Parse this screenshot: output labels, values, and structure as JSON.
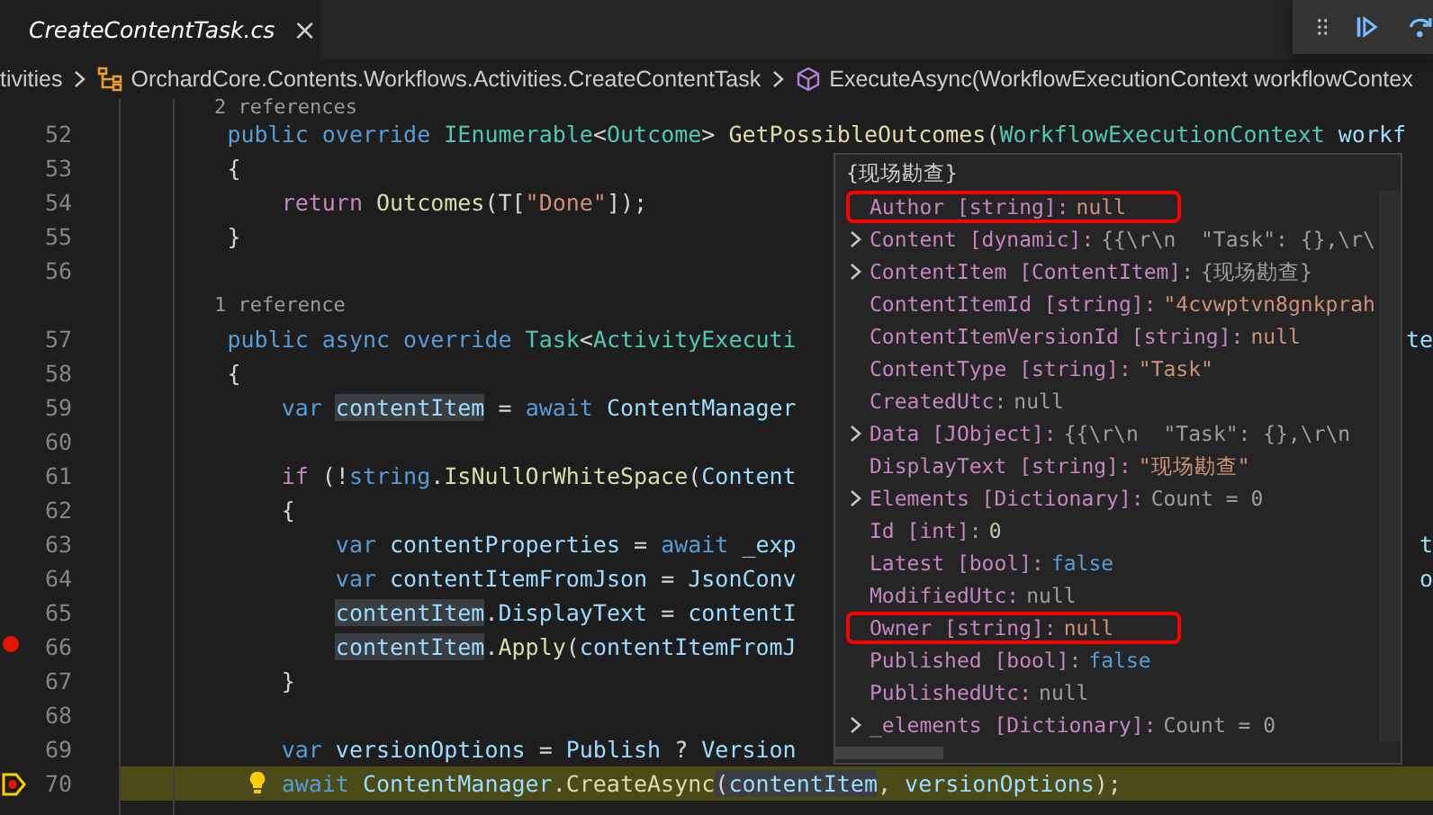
{
  "tab": {
    "title": "CreateContentTask.cs",
    "preview": true,
    "close": "×"
  },
  "breadcrumb": [
    {
      "text": "tivities"
    },
    {
      "text": "OrchardCore.Contents.Workflows.Activities.CreateContentTask"
    },
    {
      "text": "ExecuteAsync(WorkflowExecutionContext workflowContex"
    }
  ],
  "lines": [
    {
      "kind": "codelens",
      "text": "        2 references"
    },
    {
      "kind": "code",
      "number": "52",
      "breakpoint": false,
      "current": false,
      "segments": [
        {
          "t": "        public override ",
          "kind": "kw"
        },
        {
          "t": "IEnumerable",
          "kind": "type"
        },
        {
          "t": "<",
          "kind": "plain"
        },
        {
          "t": "Outcome",
          "kind": "type"
        },
        {
          "t": "> ",
          "kind": "plain"
        },
        {
          "t": "GetPossibleOutcomes",
          "kind": "fn"
        },
        {
          "t": "(",
          "kind": "plain"
        },
        {
          "t": "WorkflowExecutionContext",
          "kind": "type"
        },
        {
          "t": " workf",
          "kind": "var"
        }
      ]
    },
    {
      "kind": "code",
      "number": "53",
      "breakpoint": false,
      "current": false,
      "segments": [
        {
          "t": "        {",
          "kind": "plain"
        }
      ]
    },
    {
      "kind": "code",
      "number": "54",
      "breakpoint": false,
      "current": false,
      "segments": [
        {
          "t": "            return ",
          "kind": "ctrl"
        },
        {
          "t": "Outcomes",
          "kind": "fn"
        },
        {
          "t": "(T[",
          "kind": "plain"
        },
        {
          "t": "\"Done\"",
          "kind": "str"
        },
        {
          "t": "]);",
          "kind": "plain"
        }
      ]
    },
    {
      "kind": "code",
      "number": "55",
      "breakpoint": false,
      "current": false,
      "segments": [
        {
          "t": "        }",
          "kind": "plain"
        }
      ]
    },
    {
      "kind": "code",
      "number": "56",
      "breakpoint": false,
      "current": false
    },
    {
      "kind": "codelens",
      "text": "        1 reference"
    },
    {
      "kind": "code",
      "number": "57",
      "breakpoint": false,
      "current": false,
      "tail": "te",
      "segments": [
        {
          "t": "        public async override ",
          "kind": "kw"
        },
        {
          "t": "Task",
          "kind": "type"
        },
        {
          "t": "<",
          "kind": "plain"
        },
        {
          "t": "ActivityExecuti",
          "kind": "type"
        }
      ]
    },
    {
      "kind": "code",
      "number": "58",
      "breakpoint": false,
      "current": false,
      "segments": [
        {
          "t": "        {",
          "kind": "plain"
        }
      ]
    },
    {
      "kind": "code",
      "number": "59",
      "breakpoint": false,
      "current": false,
      "segments": [
        {
          "t": "            var ",
          "kind": "kw"
        },
        {
          "t": "contentItem",
          "kind": "var",
          "hl": true
        },
        {
          "t": " = ",
          "kind": "plain"
        },
        {
          "t": "await ",
          "kind": "kw"
        },
        {
          "t": "ContentManager",
          "kind": "var"
        }
      ]
    },
    {
      "kind": "code",
      "number": "60",
      "breakpoint": false,
      "current": false
    },
    {
      "kind": "code",
      "number": "61",
      "breakpoint": false,
      "current": false,
      "segments": [
        {
          "t": "            if ",
          "kind": "ctrl"
        },
        {
          "t": "(!",
          "kind": "plain"
        },
        {
          "t": "string",
          "kind": "kw"
        },
        {
          "t": ".",
          "kind": "plain"
        },
        {
          "t": "IsNullOrWhiteSpace",
          "kind": "fn"
        },
        {
          "t": "(",
          "kind": "plain"
        },
        {
          "t": "Content",
          "kind": "var"
        }
      ]
    },
    {
      "kind": "code",
      "number": "62",
      "breakpoint": false,
      "current": false,
      "segments": [
        {
          "t": "            {",
          "kind": "plain"
        }
      ]
    },
    {
      "kind": "code",
      "number": "63",
      "breakpoint": false,
      "current": false,
      "tail": "t",
      "segments": [
        {
          "t": "                var ",
          "kind": "kw"
        },
        {
          "t": "contentProperties",
          "kind": "var"
        },
        {
          "t": " = ",
          "kind": "plain"
        },
        {
          "t": "await ",
          "kind": "kw"
        },
        {
          "t": "_exp",
          "kind": "var"
        }
      ]
    },
    {
      "kind": "code",
      "number": "64",
      "breakpoint": false,
      "current": false,
      "tail": "o",
      "segments": [
        {
          "t": "                var ",
          "kind": "kw"
        },
        {
          "t": "contentItemFromJson",
          "kind": "var"
        },
        {
          "t": " = ",
          "kind": "plain"
        },
        {
          "t": "JsonConv",
          "kind": "var"
        }
      ]
    },
    {
      "kind": "code",
      "number": "65",
      "breakpoint": false,
      "current": false,
      "segments": [
        {
          "t": "                contentItem",
          "kind": "var",
          "hl": true
        },
        {
          "t": ".",
          "kind": "plain"
        },
        {
          "t": "DisplayText",
          "kind": "var"
        },
        {
          "t": " = ",
          "kind": "plain"
        },
        {
          "t": "contentI",
          "kind": "var"
        }
      ]
    },
    {
      "kind": "code",
      "number": "66",
      "breakpoint": true,
      "current": false,
      "segments": [
        {
          "t": "                contentItem",
          "kind": "var",
          "hl": true
        },
        {
          "t": ".",
          "kind": "plain"
        },
        {
          "t": "Apply",
          "kind": "fn"
        },
        {
          "t": "(",
          "kind": "plain"
        },
        {
          "t": "contentItemFromJ",
          "kind": "var"
        }
      ]
    },
    {
      "kind": "code",
      "number": "67",
      "breakpoint": false,
      "current": false,
      "segments": [
        {
          "t": "            }",
          "kind": "plain"
        }
      ]
    },
    {
      "kind": "code",
      "number": "68",
      "breakpoint": false,
      "current": false
    },
    {
      "kind": "code",
      "number": "69",
      "breakpoint": false,
      "current": false,
      "segments": [
        {
          "t": "            var ",
          "kind": "kw"
        },
        {
          "t": "versionOptions",
          "kind": "var"
        },
        {
          "t": " = ",
          "kind": "plain"
        },
        {
          "t": "Publish",
          "kind": "var"
        },
        {
          "t": " ? ",
          "kind": "plain"
        },
        {
          "t": "Version",
          "kind": "var"
        }
      ]
    },
    {
      "kind": "code",
      "number": "70",
      "breakpoint": true,
      "current": true,
      "segments": [
        {
          "t": "            await ",
          "kind": "kw"
        },
        {
          "t": "ContentManager",
          "kind": "var"
        },
        {
          "t": ".",
          "kind": "plain"
        },
        {
          "t": "CreateAsync",
          "kind": "fn"
        },
        {
          "t": "(",
          "kind": "plain",
          "hl": true
        },
        {
          "t": "contentItem",
          "kind": "var",
          "hl": true
        },
        {
          "t": ", ",
          "kind": "plain"
        },
        {
          "t": "versionOptions",
          "kind": "var"
        },
        {
          "t": ");",
          "kind": "plain"
        }
      ]
    }
  ],
  "hover": {
    "title": "{现场勘查}",
    "rows": [
      {
        "expandable": false,
        "marked": true,
        "label": "Author [string]:",
        "value": "null",
        "kind": "str"
      },
      {
        "expandable": true,
        "marked": false,
        "label": "Content [dynamic]:",
        "value": "{{\\r\\n  \"Task\": {},\\r\\",
        "kind": "plain"
      },
      {
        "expandable": true,
        "marked": false,
        "label": "ContentItem [ContentItem]:",
        "value": "{现场勘查}",
        "kind": "plain"
      },
      {
        "expandable": false,
        "marked": false,
        "label": "ContentItemId [string]:",
        "value": "\"4cvwptvn8gnkprah",
        "kind": "str"
      },
      {
        "expandable": false,
        "marked": false,
        "label": "ContentItemVersionId [string]:",
        "value": "null",
        "kind": "str"
      },
      {
        "expandable": false,
        "marked": false,
        "label": "ContentType [string]:",
        "value": "\"Task\"",
        "kind": "str"
      },
      {
        "expandable": false,
        "marked": false,
        "label": "CreatedUtc:",
        "value": "null",
        "kind": "plain"
      },
      {
        "expandable": true,
        "marked": false,
        "label": "Data [JObject]:",
        "value": "{{\\r\\n  \"Task\": {},\\r\\n",
        "kind": "plain"
      },
      {
        "expandable": false,
        "marked": false,
        "label": "DisplayText [string]:",
        "value": "\"现场勘查\"",
        "kind": "str"
      },
      {
        "expandable": true,
        "marked": false,
        "label": "Elements [Dictionary]:",
        "value": "Count = 0",
        "kind": "plain"
      },
      {
        "expandable": false,
        "marked": false,
        "label": "Id [int]:",
        "value": "0",
        "kind": "num"
      },
      {
        "expandable": false,
        "marked": false,
        "label": "Latest [bool]:",
        "value": "false",
        "kind": "bool"
      },
      {
        "expandable": false,
        "marked": false,
        "label": "ModifiedUtc:",
        "value": "null",
        "kind": "plain"
      },
      {
        "expandable": false,
        "marked": true,
        "label": "Owner [string]:",
        "value": "null",
        "kind": "str"
      },
      {
        "expandable": false,
        "marked": false,
        "label": "Published [bool]:",
        "value": "false",
        "kind": "bool"
      },
      {
        "expandable": false,
        "marked": false,
        "label": "PublishedUtc:",
        "value": "null",
        "kind": "plain"
      },
      {
        "expandable": true,
        "marked": false,
        "label": "_elements [Dictionary]:",
        "value": "Count = 0",
        "kind": "plain"
      }
    ]
  }
}
